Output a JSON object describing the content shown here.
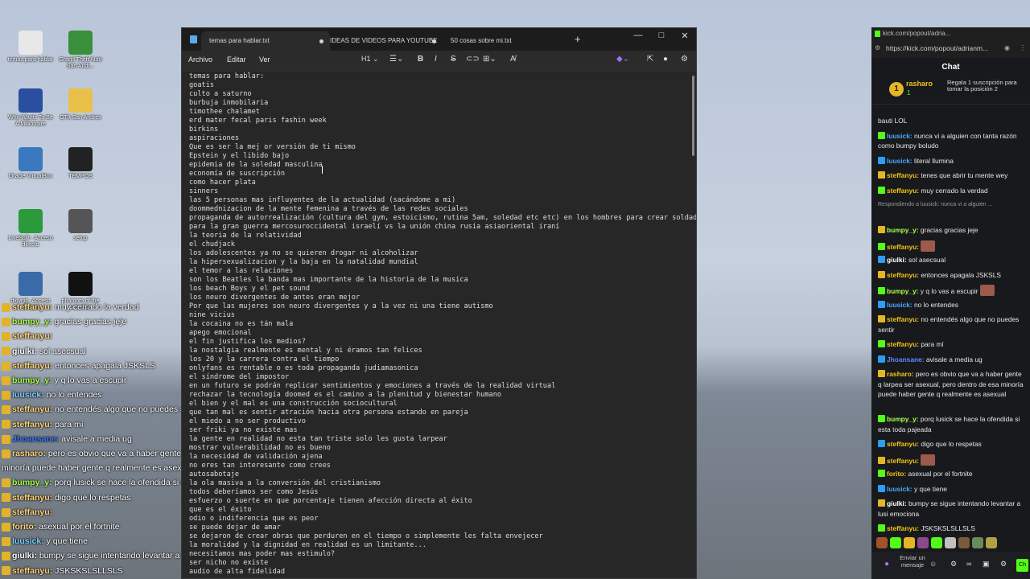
{
  "desktop": {
    "icons": [
      {
        "label": "temas para hablar",
        "color": "#e8e8e8"
      },
      {
        "label": "Grand Theft Auto San Andr...",
        "color": "#3a8f3a"
      },
      {
        "label": "Who Wants To Be A Millionaire",
        "color": "#2a4fa0"
      },
      {
        "label": "GTA San Andres",
        "color": "#e8c04a"
      },
      {
        "label": "Oracle VirtualBox",
        "color": "#3a78c0"
      },
      {
        "label": "TEMPOS",
        "color": "#222"
      },
      {
        "label": "LiveSplit - Acceso directo",
        "color": "#2a9a3a"
      },
      {
        "label": "setup",
        "color": "#555"
      },
      {
        "label": "dxwnd - Acceso directo",
        "color": "#3a6aa8"
      },
      {
        "label": "phantom of the paradise",
        "color": "#111"
      }
    ],
    "overlay_chat": [
      {
        "user": "steffanyu:",
        "text": " muy cerrado la verdad",
        "color": "#ffd37a"
      },
      {
        "user": "bumpy_y:",
        "text": " gracias gracias jeje",
        "color": "#a8ff4a"
      },
      {
        "user": "steffanyu:",
        "text": "",
        "color": "#ffd37a"
      },
      {
        "user": "giulki:",
        "text": " sol asecsual",
        "color": "#ffffff"
      },
      {
        "user": "steffanyu:",
        "text": " entonces apagala JSKSLS",
        "color": "#ffd37a"
      },
      {
        "user": "bumpy_y:",
        "text": " y q lo vas a escupir",
        "color": "#a8ff4a"
      },
      {
        "user": "luusick:",
        "text": " no lo entendes",
        "color": "#7ad0ff"
      },
      {
        "user": "steffanyu:",
        "text": " no entendés algo que no puedes sentir",
        "color": "#ffd37a"
      },
      {
        "user": "steffanyu:",
        "text": " para mí",
        "color": "#ffd37a"
      },
      {
        "user": "Jhoansane:",
        "text": " avisale a media ug",
        "color": "#3a7aff"
      },
      {
        "user": "rasharo:",
        "text": " pero es obvio que va a haber gente q larpea ser asexual, pero dentro de esa",
        "color": "#ffd37a"
      },
      {
        "user": "",
        "text": "minoría puede haber gente q realmente es asexual",
        "color": "#ffffff"
      },
      {
        "user": "bumpy_y:",
        "text": " porq lusick se hace la ofendida si esta toda pajeada",
        "color": "#a8ff4a"
      },
      {
        "user": "steffanyu:",
        "text": " digo que lo respetas",
        "color": "#ffd37a"
      },
      {
        "user": "steffanyu:",
        "text": "",
        "color": "#ffd37a"
      },
      {
        "user": "forito:",
        "text": " asexual por el fortnite",
        "color": "#ffd37a"
      },
      {
        "user": "luusick:",
        "text": " y que tiene",
        "color": "#7ad0ff"
      },
      {
        "user": "giulki:",
        "text": " bumpy se sigue intentando levantar a lusi",
        "color": "#ffffff"
      },
      {
        "user": "steffanyu:",
        "text": " JSKSKSLSLLSLS",
        "color": "#ffd37a"
      }
    ]
  },
  "notepad": {
    "tabs": [
      {
        "label": "temas para hablar.txt",
        "active": true
      },
      {
        "label": "IDEAS DE VIDEOS PARA YOUTUBE",
        "active": false
      },
      {
        "label": "50 cosas sobre mi.txt",
        "active": false
      }
    ],
    "menu": [
      "Archivo",
      "Editar",
      "Ver"
    ],
    "toolbar": {
      "heading": "H1"
    },
    "text": "temas para hablar:\ngoatis\nculto a saturno\nburbuja inmobilaria\ntimothee chalamet\nerd mater fecal paris fashin week\nbirkins\naspiraciones\nQue es ser la mej or versión de ti mismo\nEpstein y el libido bajo\nepidemia de la soledad masculina\neconomía de suscripción\ncomo hacer plata\nsinners\nlas 5 personas mas influyentes de la actualidad (sacándome a mi)\ndoommednizacion de la mente femenina a través de las redes sociales\npropaganda de autorrealización (cultura del gym, estoicismo, rutina 5am, soledad etc etc) en los hombres para crear soldados\npara la gran guerra mercosuroccidental israelí vs la unión china rusia asiaoriental iraní\nla teoria de la relatividad\nel chudjack\nlos adolescentes ya no se quieren drogar ni alcoholizar\nla hipersexualizacion y la baja en la natalidad mundial\nel temor a las relaciones\nson los Beatles la banda mas importante de la historia de la musica\nlos beach Boys y el pet sound\nlos neuro divergentes de antes eran mejor\nPor que las mujeres son neuro divergentes y a la vez ni una tiene autismo\nnine vicius\nla cocaina no es tán mala\napego emocional\nel fin justifica los medios?\nla nostalgia realmente es mental y ni éramos tan felices\nlos 20 y la carrera contra el tiempo\nonlyfans es rentable o es toda propaganda judiamasonica\nel síndrome del impostor\nen un futuro se podrán replicar sentimientos y emociones a través de la realidad virtual\nrechazar la tecnología doomed es el camino a la plenitud y bienestar humano\nel bien y el mal es una construcción sociocultural\nque tan mal es sentir atración hacia otra persona estando en pareja\nel miedo a no ser productivo\nser friki ya no existe mas\nla gente en realidad no esta tan triste solo les gusta larpear\nmostrar vulnerabilidad no es bueno\nla necesidad de validación ajena\nno eres tan interesante como crees\nautosabotaje\nla ola masiva a la conversión del cristianismo\ntodos deberíamos ser como Jesús\nesfuerzo o suerte en que porcentaje tienen afección directa al éxito\nque es el éxito\nodio o indiferencia que es peor\nse puede dejar de amar\nse dejaron de crear obras que perduren en el tiempo o simplemente les falta envejecer\nla moralidad y la dignidad en realidad es un limitante...\nnecesitamos mas poder mas estimulo?\nser nicho no existe\naudio de alta fidelidad"
  },
  "kick": {
    "window_title": "kick.com/popout/adria...",
    "url": "https://kick.com/popout/adrianm...",
    "chat_label": "Chat",
    "pinned": {
      "coin": "1",
      "user": "rasharo",
      "count": "1",
      "text": "Regala 1 suscripción para tomar la posición 2"
    },
    "messages": [
      {
        "user": "",
        "text": "bauti LOL",
        "color": "#e6e6e6"
      },
      {
        "user": "luusick:",
        "text": " nunca vi a alguien con tanta razón como bumpy boludo",
        "color": "#4aa8ff"
      },
      {
        "user": "luusick:",
        "text": " literal llumina",
        "color": "#4aa8ff"
      },
      {
        "user": "steffanyu:",
        "text": " tenes que abrir tu mente wey",
        "color": "#f0c419"
      },
      {
        "user": "steffanyu:",
        "text": " muy cerrado la verdad",
        "color": "#f0c419"
      },
      {
        "user": "",
        "text": "Respondiendo a luusick: nunca vi a alguien ...",
        "color": "#9a9a9a",
        "reply": true
      },
      {
        "user": "bumpy_y:",
        "text": " gracias gracias jeje",
        "color": "#a8ff4a"
      },
      {
        "user": "steffanyu:",
        "text": "",
        "color": "#f0c419",
        "emote": true
      },
      {
        "user": "giulki:",
        "text": " sol asecsual",
        "color": "#ffffff"
      },
      {
        "user": "steffanyu:",
        "text": " entonces apagala JSKSLS",
        "color": "#f0c419"
      },
      {
        "user": "bumpy_y:",
        "text": " y q lo vas a escupir",
        "color": "#a8ff4a",
        "emote": true
      },
      {
        "user": "luusick:",
        "text": " no lo entendes",
        "color": "#4aa8ff"
      },
      {
        "user": "steffanyu:",
        "text": " no entendés algo que no puedes sentir",
        "color": "#f0c419"
      },
      {
        "user": "steffanyu:",
        "text": " para mí",
        "color": "#f0c419"
      },
      {
        "user": "Jhoansane:",
        "text": " avisale a media ug",
        "color": "#5a8aff"
      },
      {
        "user": "rasharo:",
        "text": " pero es obvio que va a haber gente q larpea ser asexual, pero dentro de esa minoría puede haber gente q realmente es asexual",
        "color": "#f0c419"
      },
      {
        "user": "bumpy_y:",
        "text": " porq lusick se hace la ofendida si esta toda pajeada",
        "color": "#a8ff4a"
      },
      {
        "user": "steffanyu:",
        "text": " digo que lo respetas",
        "color": "#f0c419"
      },
      {
        "user": "steffanyu:",
        "text": "",
        "color": "#f0c419",
        "emote": true
      },
      {
        "user": "forito:",
        "text": " asexual por el fortnite",
        "color": "#f0c419"
      },
      {
        "user": "luusick:",
        "text": " y que tiene",
        "color": "#4aa8ff"
      },
      {
        "user": "giulki:",
        "text": " bumpy se sigue intentando levantar a lusi emociona",
        "color": "#ffffff"
      },
      {
        "user": "steffanyu:",
        "text": " JSKSKSLSLLSLS",
        "color": "#f0c419"
      }
    ],
    "input_placeholder": "Enviar un mensaje",
    "send_label": "Ch"
  }
}
